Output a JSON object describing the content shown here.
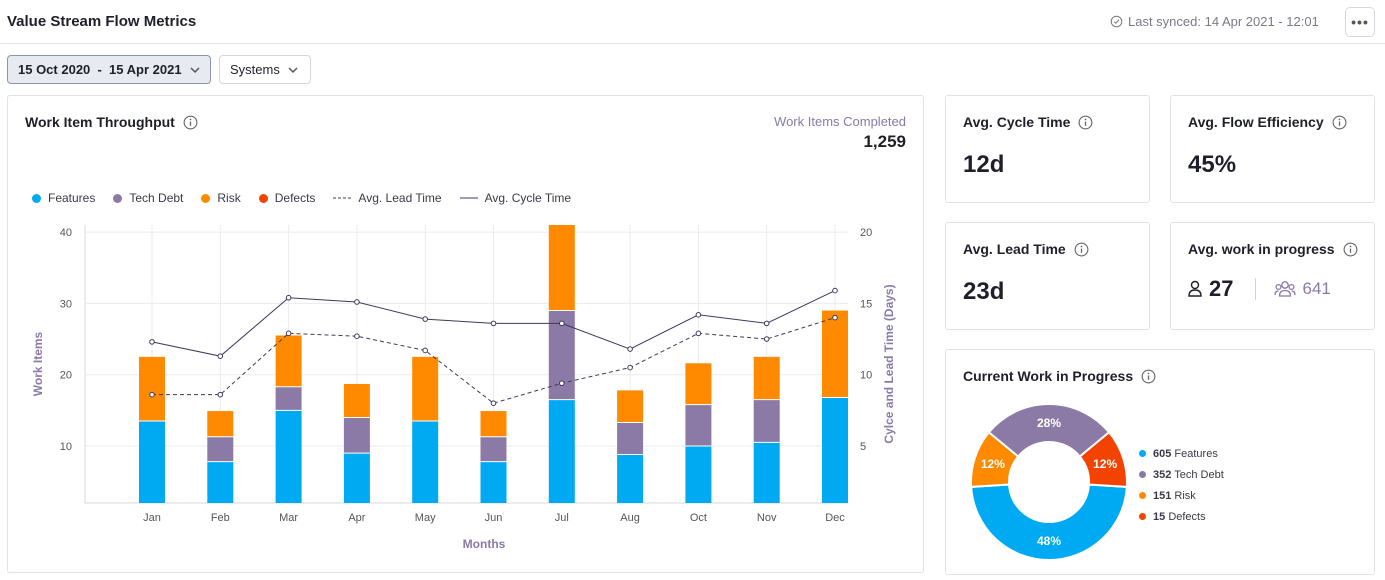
{
  "header": {
    "title": "Value Stream Flow Metrics",
    "last_synced": "Last synced: 14 Apr 2021 - 12:01",
    "more_label": "•••"
  },
  "filters": {
    "date_range": "15 Oct 2020  -  15 Apr 2021",
    "systems": "Systems"
  },
  "throughput": {
    "title": "Work Item Throughput",
    "completed_label": "Work Items Completed",
    "completed_value": "1,259",
    "legend": {
      "features": "Features",
      "tech_debt": "Tech Debt",
      "risk": "Risk",
      "defects": "Defects",
      "lead_time": "Avg. Lead Time",
      "cycle_time": "Avg. Cycle Time"
    }
  },
  "kpis": {
    "cycle": {
      "title": "Avg. Cycle Time",
      "value": "12d"
    },
    "flow": {
      "title": "Avg. Flow Efficiency",
      "value": "45%"
    },
    "lead": {
      "title": "Avg. Lead Time",
      "value": "23d"
    },
    "wip": {
      "title": "Avg. work in progress",
      "me": "27",
      "team": "641"
    }
  },
  "current_wip": {
    "title": "Current Work in Progress",
    "legend": [
      {
        "count": "605",
        "label": "Features",
        "color": "#00aaf2"
      },
      {
        "count": "352",
        "label": "Tech Debt",
        "color": "#8c7aa6"
      },
      {
        "count": "151",
        "label": "Risk",
        "color": "#ff8a00"
      },
      {
        "count": "15",
        "label": "Defects",
        "color": "#f24300"
      }
    ]
  },
  "colors": {
    "features": "#00aaf2",
    "tech_debt": "#8c7aa6",
    "risk": "#ff8a00",
    "defects": "#f24300",
    "line": "#3d3a5c",
    "accent_text": "#8a7aa8"
  },
  "chart_data": [
    {
      "type": "bar",
      "title": "Work Item Throughput",
      "xlabel": "Months",
      "ylabel": "Work Items",
      "y2label": "Cylce and Lead Time (Days)",
      "categories": [
        "Jan",
        "Feb",
        "Mar",
        "Apr",
        "May",
        "Jun",
        "Jul",
        "Aug",
        "Oct",
        "Nov",
        "Dec"
      ],
      "stacked": true,
      "ylim": [
        2,
        41
      ],
      "y_ticks": [
        10,
        20,
        30,
        40
      ],
      "y2lim": [
        1,
        20.5
      ],
      "y2_ticks": [
        5,
        10,
        15,
        20
      ],
      "grid": true,
      "legend_position": "top-left",
      "series": [
        {
          "name": "Features",
          "values": [
            11.5,
            5.8,
            13,
            7,
            11.5,
            5.8,
            14.5,
            6.8,
            8,
            8.5,
            14.8
          ]
        },
        {
          "name": "Tech Debt",
          "values": [
            0,
            3.5,
            3.3,
            5,
            0,
            3.5,
            12.5,
            4.5,
            5.8,
            6,
            0
          ]
        },
        {
          "name": "Risk",
          "values": [
            9,
            3.6,
            7.2,
            4.7,
            9,
            3.6,
            12,
            4.5,
            5.8,
            6,
            12.2
          ]
        },
        {
          "name": "Defects",
          "values": [
            0,
            0,
            0,
            0,
            0,
            0,
            0,
            0,
            0,
            0,
            0
          ]
        }
      ],
      "lines": [
        {
          "name": "Avg. Lead Time",
          "axis": "right",
          "style": "dashed",
          "values": [
            8.6,
            8.6,
            12.9,
            12.7,
            11.7,
            8,
            9.4,
            10.5,
            12.9,
            12.5,
            14
          ]
        },
        {
          "name": "Avg. Cycle Time",
          "axis": "right",
          "style": "solid",
          "values": [
            12.3,
            11.3,
            15.4,
            15.1,
            13.9,
            13.6,
            13.6,
            11.8,
            14.2,
            13.6,
            15.9
          ]
        }
      ]
    },
    {
      "type": "pie",
      "title": "Current Work in Progress",
      "donut": true,
      "categories": [
        "Features",
        "Tech Debt",
        "Risk",
        "Defects"
      ],
      "values": [
        605,
        352,
        151,
        15
      ],
      "labels": [
        "48%",
        "28%",
        "12%",
        "12%"
      ],
      "slice_percent": [
        48,
        28,
        12,
        12
      ]
    }
  ]
}
